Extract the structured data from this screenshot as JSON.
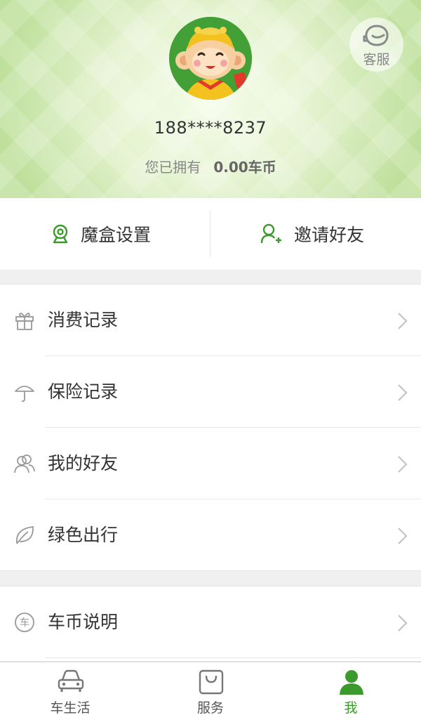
{
  "header": {
    "phone": "188****8237",
    "balance_label": "您已拥有",
    "balance_amount": "0.00车币",
    "service_label": "客服"
  },
  "quick_actions": [
    {
      "label": "魔盒设置",
      "icon": "location-pin-icon"
    },
    {
      "label": "邀请好友",
      "icon": "add-user-icon"
    }
  ],
  "menu": {
    "group1": [
      {
        "label": "消费记录",
        "icon": "gift-icon"
      },
      {
        "label": "保险记录",
        "icon": "umbrella-icon"
      },
      {
        "label": "我的好友",
        "icon": "friends-icon"
      },
      {
        "label": "绿色出行",
        "icon": "leaf-icon"
      }
    ],
    "group2": [
      {
        "label": "车币说明",
        "icon": "car-coin-icon",
        "icon_char": "车"
      }
    ]
  },
  "nav": {
    "tabs": [
      {
        "label": "车生活",
        "icon": "car-icon",
        "active": false
      },
      {
        "label": "服务",
        "icon": "shopping-bag-icon",
        "active": false
      },
      {
        "label": "我",
        "icon": "person-icon",
        "active": true
      }
    ]
  },
  "colors": {
    "accent": "#3c9a2d",
    "header_green": "#bfe09c"
  }
}
